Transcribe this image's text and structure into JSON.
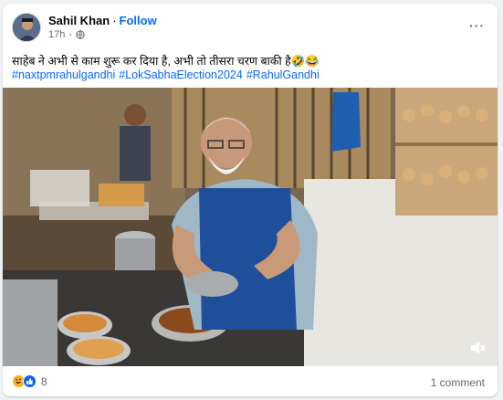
{
  "post": {
    "author": "Sahil Khan",
    "separator": "·",
    "follow_label": "Follow",
    "timestamp": "17h",
    "more_label": "···",
    "caption": "साहेब ने अभी से काम शुरू कर दिया है, अभी तो तीसरा चरण बाकी है🤣😂",
    "hashtags": [
      "#naxtpmrahulgandhi",
      "#LokSabhaElection2024",
      "#RahulGandhi"
    ]
  },
  "video": {
    "description_icon": "volume-muted-icon"
  },
  "footer": {
    "reaction_count": "8",
    "comments_label": "1 comment"
  },
  "colors": {
    "link": "#0866ff",
    "secondary_text": "#65676b",
    "like": "#0866ff",
    "haha": "#f7b125"
  }
}
